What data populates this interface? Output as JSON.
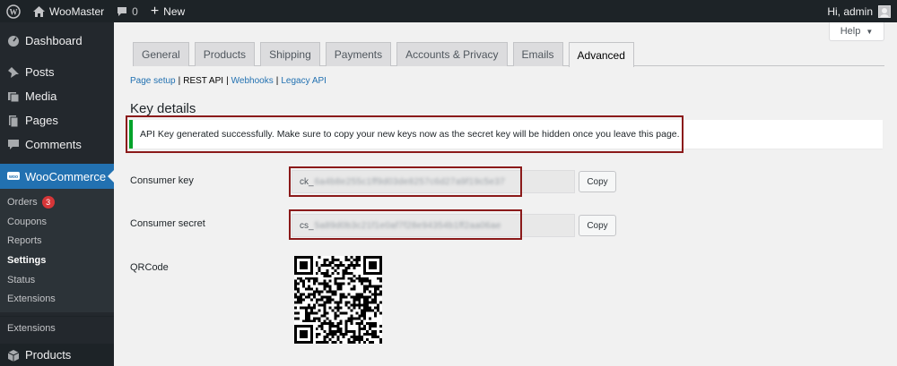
{
  "adminbar": {
    "site_name": "WooMaster",
    "comments_count": "0",
    "new_label": "New",
    "greeting": "Hi, admin"
  },
  "sidebar": {
    "top_items": [
      {
        "label": "Dashboard",
        "icon": "dashboard-icon"
      },
      {
        "label": "Posts",
        "icon": "pin-icon"
      },
      {
        "label": "Media",
        "icon": "media-icon"
      },
      {
        "label": "Pages",
        "icon": "pages-icon"
      },
      {
        "label": "Comments",
        "icon": "comment-icon"
      }
    ],
    "woocommerce_label": "WooCommerce",
    "submenu": [
      {
        "label": "Orders",
        "badge": "3"
      },
      {
        "label": "Coupons"
      },
      {
        "label": "Reports"
      },
      {
        "label": "Settings"
      },
      {
        "label": "Status"
      },
      {
        "label": "Extensions"
      }
    ],
    "extensions_label": "Extensions",
    "products_label": "Products"
  },
  "help_label": "Help",
  "tabs": [
    "General",
    "Products",
    "Shipping",
    "Payments",
    "Accounts & Privacy",
    "Emails",
    "Advanced"
  ],
  "active_tab": "Advanced",
  "subnav": {
    "page_setup": "Page setup",
    "rest_api": "REST API",
    "webhooks": "Webhooks",
    "legacy_api": "Legacy API",
    "separator": "|"
  },
  "heading": "Key details",
  "notice": "API Key generated successfully. Make sure to copy your new keys now as the secret key will be hidden once you leave this page.",
  "consumer_key": {
    "label": "Consumer key",
    "prefix": "ck_",
    "masked": "6a4b8e255c1ff9d03de8257c6d27a9f19c5e37",
    "copy": "Copy"
  },
  "consumer_secret": {
    "label": "Consumer secret",
    "prefix": "cs_",
    "masked": "5a89d0b3c21f1e0af7f28e94354b1ff2aa06ae",
    "copy": "Copy"
  },
  "qrcode_label": "QRCode",
  "colors": {
    "adminbar": "#1d2327",
    "sidebar": "#23282d",
    "accent": "#2271b1",
    "notice_border": "#00a32a",
    "highlight": "#8b1a1a",
    "badge": "#d63638"
  }
}
